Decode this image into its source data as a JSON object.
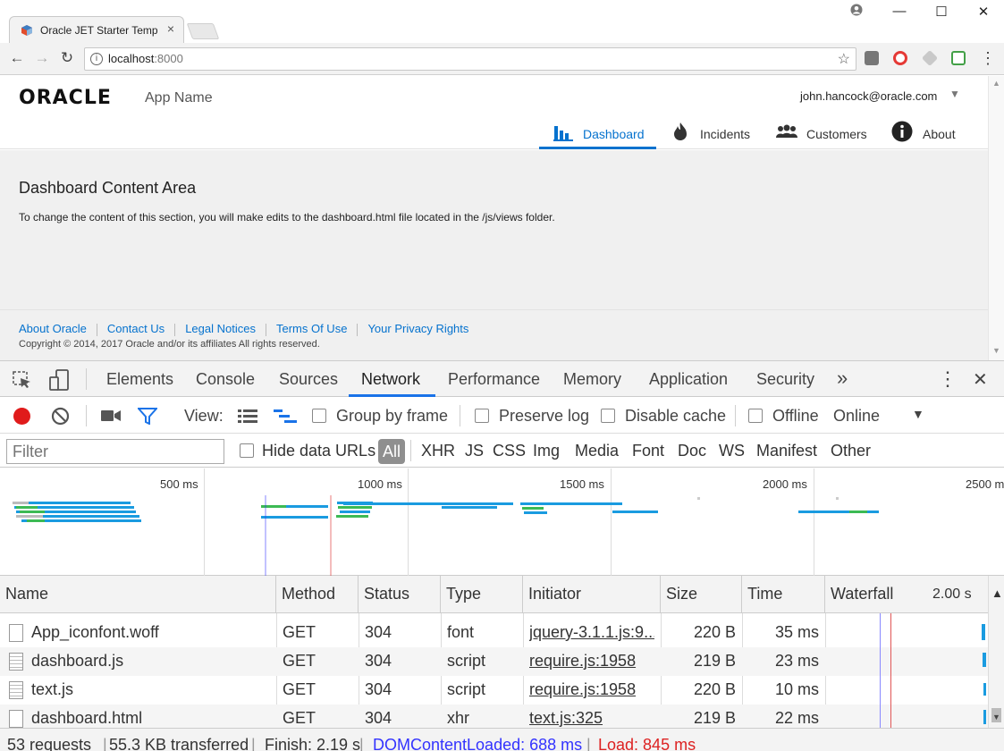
{
  "browser": {
    "tab_title": "Oracle JET Starter Templa",
    "tab_close": "×",
    "window_controls": {
      "user": "👤",
      "minimize": "—",
      "maximize": "☐",
      "close": "✕"
    },
    "nav": {
      "back": "←",
      "forward": "→",
      "reload": "↻"
    },
    "url_host": "localhost",
    "url_port": ":8000",
    "info_glyph": "i",
    "star_glyph": "☆",
    "menu_glyph": "⋮"
  },
  "app": {
    "logo": "ORACLE",
    "app_name": "App Name",
    "user_email": "john.hancock@oracle.com",
    "user_caret": "▼",
    "nav": [
      {
        "label": "Dashboard",
        "icon": "bar-chart-icon",
        "active": true
      },
      {
        "label": "Incidents",
        "icon": "fire-icon",
        "active": false
      },
      {
        "label": "Customers",
        "icon": "people-icon",
        "active": false
      },
      {
        "label": "About",
        "icon": "info-icon",
        "active": false
      }
    ],
    "content_title": "Dashboard Content Area",
    "content_text": "To change the content of this section, you will make edits to the dashboard.html file located in the /js/views folder.",
    "footer_links": [
      "About Oracle",
      "Contact Us",
      "Legal Notices",
      "Terms Of Use",
      "Your Privacy Rights"
    ],
    "copyright": "Copyright © 2014, 2017 Oracle and/or its affiliates All rights reserved."
  },
  "devtools": {
    "tabs": [
      "Elements",
      "Console",
      "Sources",
      "Network",
      "Performance",
      "Memory",
      "Application",
      "Security"
    ],
    "active_tab": "Network",
    "more_tabs": "»",
    "kebab": "⋮",
    "close": "✕",
    "toolbar": {
      "view_label": "View:",
      "group_by_frame": "Group by frame",
      "preserve_log": "Preserve log",
      "disable_cache": "Disable cache",
      "offline": "Offline",
      "throttle": "Online",
      "throttle_caret": "▼"
    },
    "filter": {
      "placeholder": "Filter",
      "hide_data_urls": "Hide data URLs",
      "types": [
        "All",
        "XHR",
        "JS",
        "CSS",
        "Img",
        "Media",
        "Font",
        "Doc",
        "WS",
        "Manifest",
        "Other"
      ]
    },
    "overview_ticks": [
      "500 ms",
      "1000 ms",
      "1500 ms",
      "2000 ms",
      "2500 ms"
    ],
    "columns": {
      "name": "Name",
      "method": "Method",
      "status": "Status",
      "type": "Type",
      "initiator": "Initiator",
      "size": "Size",
      "time": "Time",
      "waterfall": "Waterfall",
      "waterfall_scale": "2.00 s"
    },
    "rows": [
      {
        "name": "App_iconfont.woff",
        "method": "GET",
        "status": "304",
        "type": "font",
        "initiator": "jquery-3.1.1.js:9...",
        "size": "220 B",
        "time": "35 ms"
      },
      {
        "name": "dashboard.js",
        "method": "GET",
        "status": "304",
        "type": "script",
        "initiator": "require.js:1958",
        "size": "219 B",
        "time": "23 ms"
      },
      {
        "name": "text.js",
        "method": "GET",
        "status": "304",
        "type": "script",
        "initiator": "require.js:1958",
        "size": "220 B",
        "time": "10 ms"
      },
      {
        "name": "dashboard.html",
        "method": "GET",
        "status": "304",
        "type": "xhr",
        "initiator": "text.js:325",
        "size": "219 B",
        "time": "22 ms"
      }
    ],
    "status_bar": {
      "requests": "53 requests",
      "transferred": "55.3 KB transferred",
      "finish": "Finish: 2.19 s",
      "dom_content_loaded": "DOMContentLoaded: 688 ms",
      "load": "Load: 845 ms"
    },
    "colors": {
      "dcl": "#3333ff",
      "load": "#dd2222",
      "accent": "#1a73e8",
      "bar_blue": "#1a9be0",
      "bar_green": "#3cba54"
    }
  }
}
